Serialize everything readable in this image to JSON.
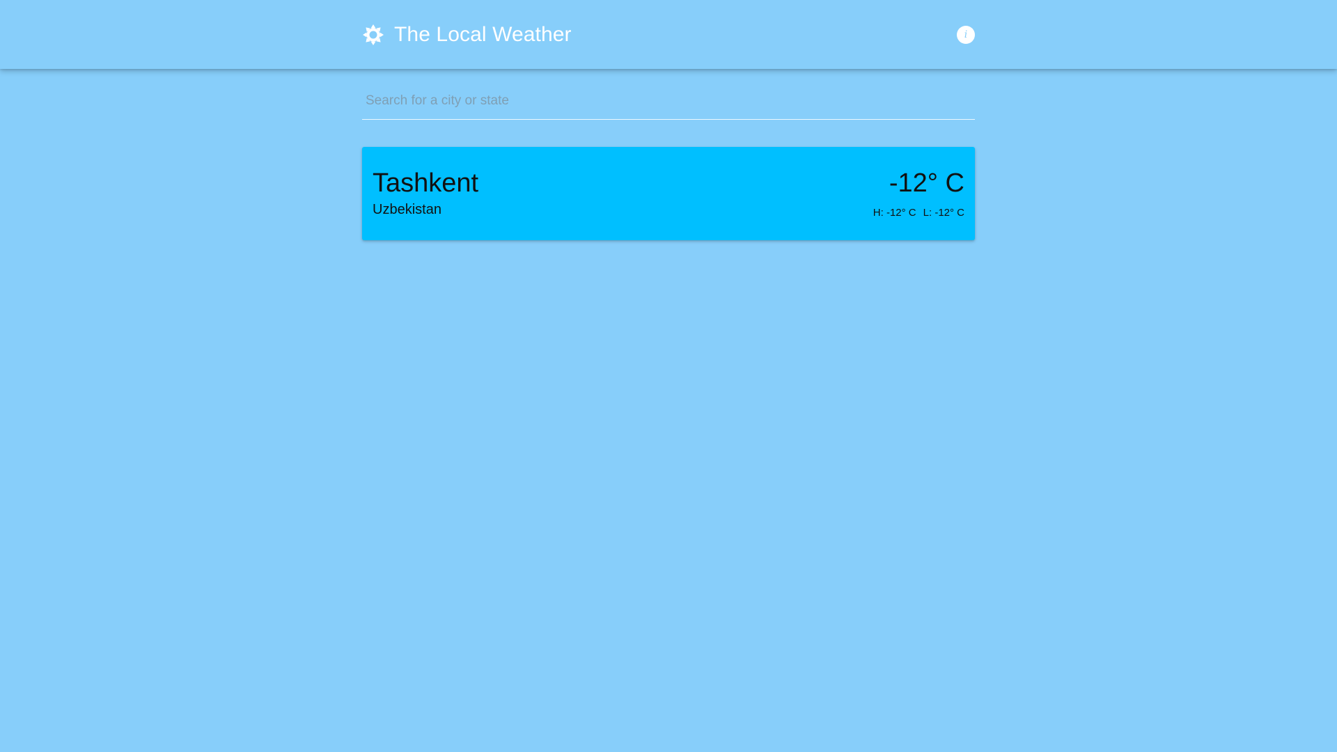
{
  "header": {
    "title": "The Local Weather",
    "logo_icon": "sun-icon",
    "info_icon": "info-icon"
  },
  "search": {
    "placeholder": "Search for a city or state",
    "value": ""
  },
  "weather_card": {
    "city": "Tashkent",
    "country": "Uzbekistan",
    "temperature": "-12° C",
    "high": "H: -12° C",
    "low": "L: -12° C"
  },
  "colors": {
    "background": "#87cefa",
    "card": "#00bfff",
    "header_text": "#ffffff",
    "card_text": "#111111"
  }
}
